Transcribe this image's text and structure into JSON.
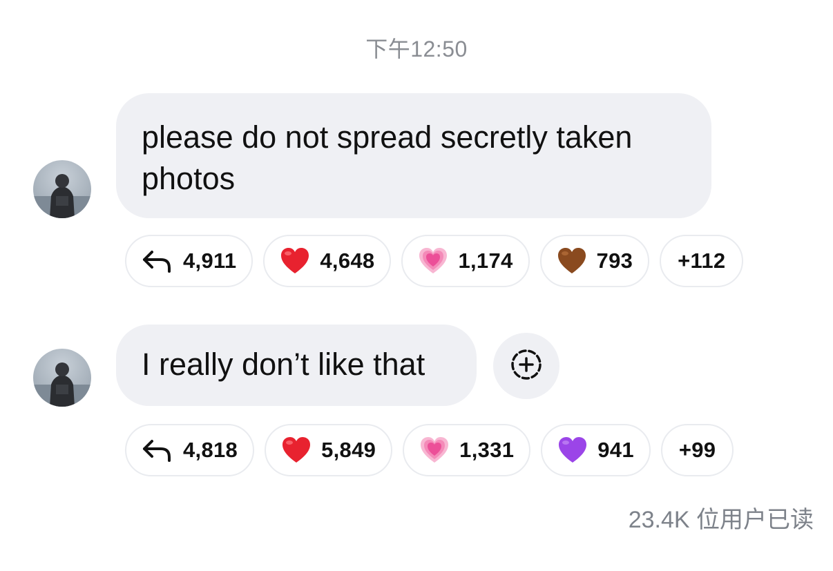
{
  "timestamp": "下午12:50",
  "messages": [
    {
      "text": "please do not spread secretly taken photos",
      "reactions": {
        "reply_count": "4,911",
        "items": [
          {
            "emoji": "red-heart",
            "count": "4,648"
          },
          {
            "emoji": "growing-pink-heart",
            "count": "1,174"
          },
          {
            "emoji": "brown-heart",
            "count": "793"
          }
        ],
        "more": "+112"
      }
    },
    {
      "text": "I really don’t like that",
      "reactions": {
        "reply_count": "4,818",
        "items": [
          {
            "emoji": "red-heart",
            "count": "5,849"
          },
          {
            "emoji": "growing-pink-heart",
            "count": "1,331"
          },
          {
            "emoji": "purple-heart",
            "count": "941"
          }
        ],
        "more": "+99"
      }
    }
  ],
  "read_receipt": "23.4K 位用户已读",
  "colors": {
    "bubble": "#eff0f4",
    "muted_text": "#8a8d93",
    "red_heart": "#e8222f",
    "pink_heart": "#f06aa8",
    "brown_heart": "#8a4a1f",
    "purple_heart": "#9b45e8"
  }
}
